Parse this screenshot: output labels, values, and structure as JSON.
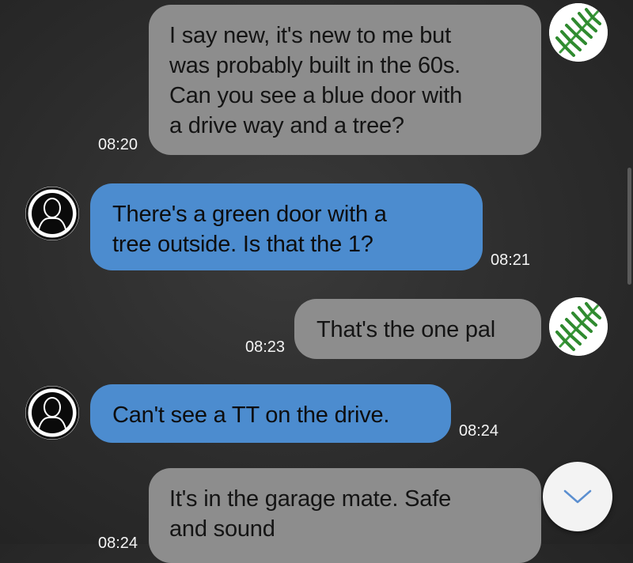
{
  "colors": {
    "outgoing_bubble": "#8d8d8d",
    "incoming_bubble": "#4c8ccf",
    "timestamp_text": "#f4f4f4",
    "background": "#2c2c2c"
  },
  "icons": {
    "outgoing_avatar": "fern-leaf-avatar-icon",
    "incoming_avatar": "person-silhouette-avatar-icon",
    "scroll_button": "chevron-down-icon"
  },
  "messages": [
    {
      "direction": "outgoing",
      "lines": [
        "I say new, it's new to me but",
        "was probably built in the 60s.",
        "Can you see a blue door with",
        "a drive way and a tree?"
      ],
      "time": "08:20"
    },
    {
      "direction": "incoming",
      "lines": [
        "There's a green door with a",
        "tree outside. Is that the 1?"
      ],
      "time": "08:21"
    },
    {
      "direction": "outgoing",
      "lines": [
        "That's the one pal"
      ],
      "time": "08:23"
    },
    {
      "direction": "incoming",
      "lines": [
        "Can't see a TT on the drive."
      ],
      "time": "08:24"
    },
    {
      "direction": "outgoing",
      "lines": [
        "It's in the garage mate. Safe",
        "and sound"
      ],
      "time": "08:24"
    }
  ]
}
